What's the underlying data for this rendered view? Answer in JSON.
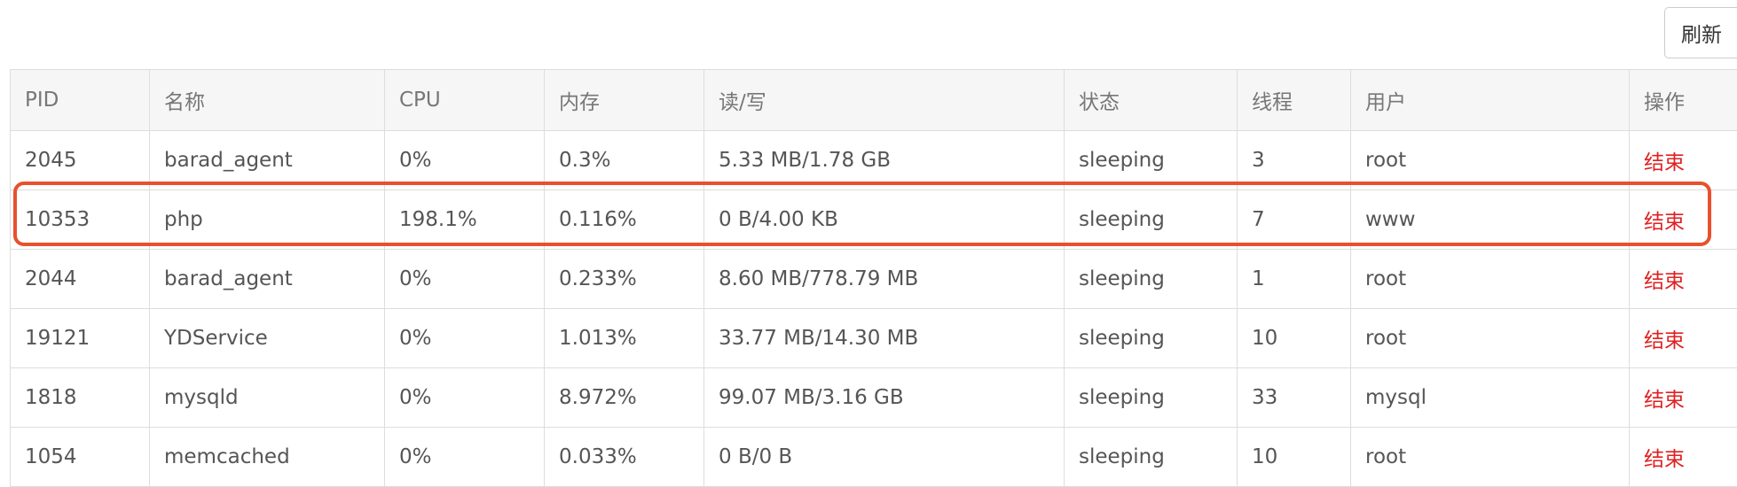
{
  "toolbar": {
    "refresh_label": "刷新"
  },
  "table": {
    "columns": [
      "PID",
      "名称",
      "CPU",
      "内存",
      "读/写",
      "状态",
      "线程",
      "用户",
      "操作"
    ],
    "rows": [
      {
        "pid": "2045",
        "name": "barad_agent",
        "cpu": "0%",
        "mem": "0.3%",
        "io": "5.33 MB/1.78 GB",
        "status": "sleeping",
        "threads": "3",
        "user": "root",
        "action": "结束"
      },
      {
        "pid": "10353",
        "name": "php",
        "cpu": "198.1%",
        "mem": "0.116%",
        "io": "0 B/4.00 KB",
        "status": "sleeping",
        "threads": "7",
        "user": "www",
        "action": "结束"
      },
      {
        "pid": "2044",
        "name": "barad_agent",
        "cpu": "0%",
        "mem": "0.233%",
        "io": "8.60 MB/778.79 MB",
        "status": "sleeping",
        "threads": "1",
        "user": "root",
        "action": "结束"
      },
      {
        "pid": "19121",
        "name": "YDService",
        "cpu": "0%",
        "mem": "1.013%",
        "io": "33.77 MB/14.30 MB",
        "status": "sleeping",
        "threads": "10",
        "user": "root",
        "action": "结束"
      },
      {
        "pid": "1818",
        "name": "mysqld",
        "cpu": "0%",
        "mem": "8.972%",
        "io": "99.07 MB/3.16 GB",
        "status": "sleeping",
        "threads": "33",
        "user": "mysql",
        "action": "结束"
      },
      {
        "pid": "1054",
        "name": "memcached",
        "cpu": "0%",
        "mem": "0.033%",
        "io": "0 B/0 B",
        "status": "sleeping",
        "threads": "10",
        "user": "root",
        "action": "结束"
      }
    ]
  },
  "annotation": {
    "highlight_color": "#e8502e",
    "highlighted_pid": "10353"
  }
}
